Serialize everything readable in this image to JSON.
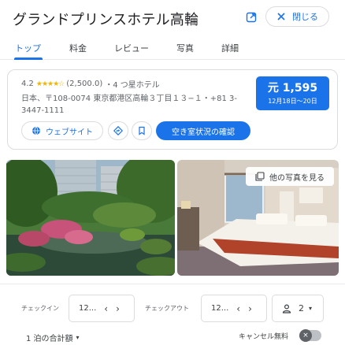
{
  "header": {
    "title": "グランドプリンスホテル高輪",
    "close_label": "閉じる"
  },
  "tabs": [
    {
      "label": "トップ",
      "active": true
    },
    {
      "label": "料金"
    },
    {
      "label": "レビュー"
    },
    {
      "label": "写真"
    },
    {
      "label": "詳細"
    }
  ],
  "overview": {
    "rating": "4.2",
    "stars": "★★★★☆",
    "review_count": "(2,500.0)",
    "class": "・4 つ星ホテル",
    "address": "日本、〒108-0074 東京都港区高輪３丁目１３−１・+81 3-3447-1111",
    "price": "元 1,595",
    "price_dates": "12月18日〜20日",
    "website_label": "ウェブサイト",
    "availability_label": "空き室状況の確認"
  },
  "photos": {
    "more_label": "他の写真を見る"
  },
  "booking": {
    "checkin_label": "チェックイン",
    "checkin_value": "12...",
    "checkout_label": "チェックアウト",
    "checkout_value": "12...",
    "guests": "2",
    "total_label": "1 泊の合計額",
    "cancel_label": "キャンセル無料"
  },
  "colors": {
    "accent": "#1a73e8",
    "star": "#f4b400"
  }
}
